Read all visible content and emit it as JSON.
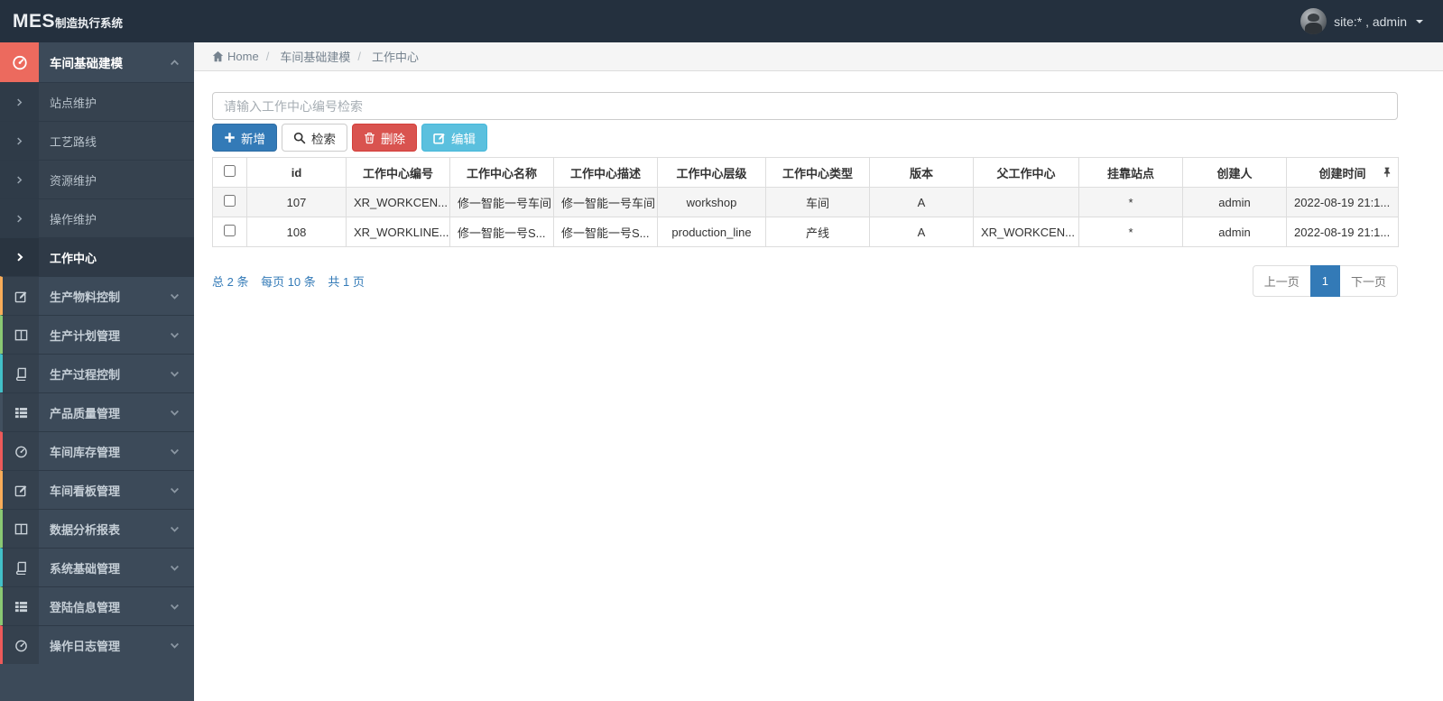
{
  "topbar": {
    "logo_mes": "MES",
    "logo_suffix": "制造执行系统",
    "user": "site:* , admin"
  },
  "breadcrumb": {
    "home": "Home",
    "level1": "车间基础建模",
    "level2": "工作中心"
  },
  "search": {
    "placeholder": "请输入工作中心编号检索"
  },
  "toolbar": {
    "add": "新增",
    "search": "检索",
    "delete": "删除",
    "edit": "编辑"
  },
  "colors": {
    "primary": "#337ab7",
    "danger": "#d9534f",
    "info": "#5bc0de",
    "sidebar_active_accent": "#ec6a5e",
    "accent_yellow": "#f8ac59",
    "accent_green": "#8ac873",
    "accent_teal": "#42c0c8",
    "accent_dark": "#42505f",
    "accent_red": "#ed5a5a"
  },
  "sidebar": {
    "active_group": {
      "label": "车间基础建模",
      "children": [
        {
          "label": "站点维护"
        },
        {
          "label": "工艺路线"
        },
        {
          "label": "资源维护"
        },
        {
          "label": "操作维护"
        },
        {
          "label": "工作中心"
        }
      ]
    },
    "groups": [
      {
        "label": "生产物料控制",
        "accent": "#f8ac59"
      },
      {
        "label": "生产计划管理",
        "accent": "#8ac873"
      },
      {
        "label": "生产过程控制",
        "accent": "#42c0c8"
      },
      {
        "label": "产品质量管理",
        "accent": "#42505f"
      },
      {
        "label": "车间库存管理",
        "accent": "#ed5a5a"
      },
      {
        "label": "车间看板管理",
        "accent": "#f8ac59"
      },
      {
        "label": "数据分析报表",
        "accent": "#8ac873"
      },
      {
        "label": "系统基础管理",
        "accent": "#42c0c8"
      },
      {
        "label": "登陆信息管理",
        "accent": "#8ac873"
      },
      {
        "label": "操作日志管理",
        "accent": "#ed5a5a"
      }
    ]
  },
  "table": {
    "headers": [
      "",
      "id",
      "工作中心编号",
      "工作中心名称",
      "工作中心描述",
      "工作中心层级",
      "工作中心类型",
      "版本",
      "父工作中心",
      "挂靠站点",
      "创建人",
      "创建时间"
    ],
    "rows": [
      {
        "id": "107",
        "code": "XR_WORKCEN...",
        "name": "修一智能一号车间",
        "desc": "修一智能一号车间",
        "level": "workshop",
        "type": "车间",
        "version": "A",
        "parent": "",
        "station": "*",
        "creator": "admin",
        "created": "2022-08-19 21:1..."
      },
      {
        "id": "108",
        "code": "XR_WORKLINE...",
        "name": "修一智能一号S...",
        "desc": "修一智能一号S...",
        "level": "production_line",
        "type": "产线",
        "version": "A",
        "parent": "XR_WORKCEN...",
        "station": "*",
        "creator": "admin",
        "created": "2022-08-19 21:1..."
      }
    ]
  },
  "pagination": {
    "summary_total": "总 2 条",
    "summary_pagesize": "每页 10 条",
    "summary_pages": "共 1 页",
    "prev": "上一页",
    "page": "1",
    "next": "下一页"
  }
}
